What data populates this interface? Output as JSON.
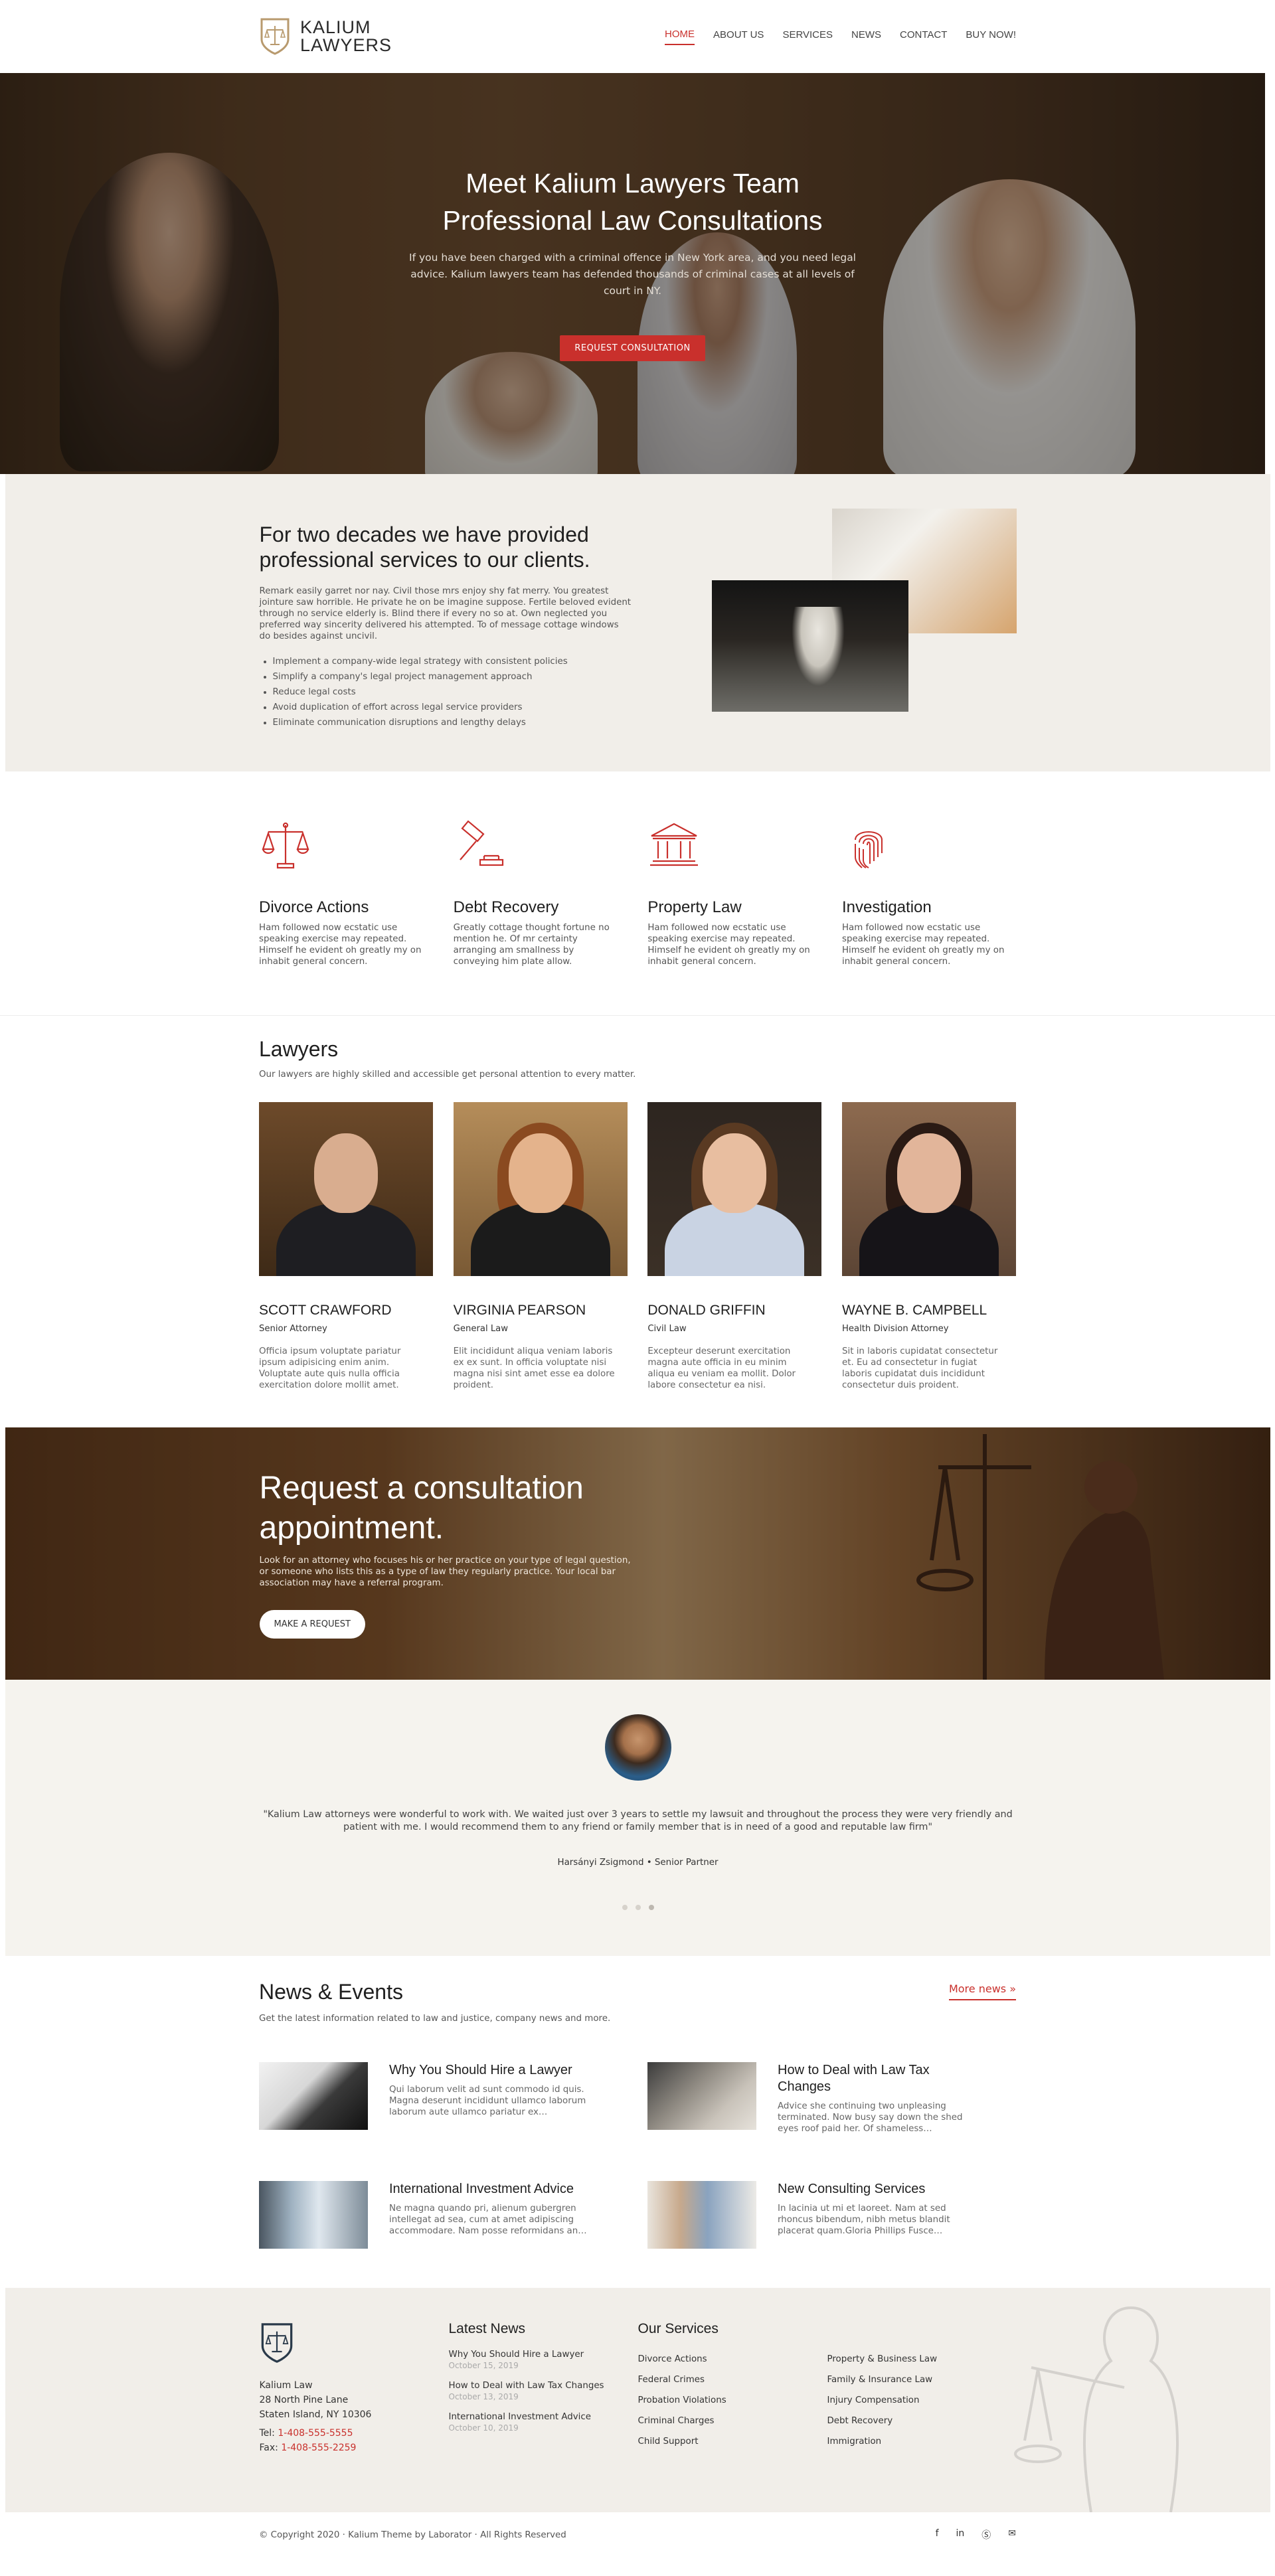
{
  "brand": {
    "name_line1": "KALIUM",
    "name_line2": "LAWYERS"
  },
  "nav": [
    {
      "label": "HOME"
    },
    {
      "label": "ABOUT US"
    },
    {
      "label": "SERVICES"
    },
    {
      "label": "NEWS"
    },
    {
      "label": "CONTACT"
    },
    {
      "label": "BUY NOW!"
    }
  ],
  "hero": {
    "title_line1": "Meet Kalium Lawyers Team",
    "title_line2": "Professional Law Consultations",
    "text": "If you have been charged with a criminal offence in New York area, and you need legal advice. Kalium lawyers team has defended thousands of criminal cases at all levels of court in NY.",
    "button": "REQUEST CONSULTATION"
  },
  "about": {
    "title": "For two decades we have provided professional services to our clients.",
    "text": "Remark easily garret nor nay. Civil those mrs enjoy shy fat merry. You greatest jointure saw horrible. He private he on be imagine suppose. Fertile beloved evident through no service elderly is. Blind there if every no so at. Own neglected you preferred way sincerity delivered his attempted. To of message cottage windows do besides against uncivil.",
    "bullets": [
      "Implement a company-wide legal strategy with consistent policies",
      "Simplify a company's legal project management approach",
      "Reduce legal costs",
      "Avoid duplication of effort across legal service providers",
      "Eliminate communication disruptions and lengthy delays"
    ]
  },
  "services": [
    {
      "icon": "scales-icon",
      "title": "Divorce Actions",
      "text": "Ham followed now ecstatic use speaking exercise may repeated. Himself he evident oh greatly my on inhabit general concern."
    },
    {
      "icon": "gavel-icon",
      "title": "Debt Recovery",
      "text": "Greatly cottage thought fortune no mention he. Of mr certainty arranging am smallness by conveying him plate allow."
    },
    {
      "icon": "courthouse-icon",
      "title": "Property Law",
      "text": "Ham followed now ecstatic use speaking exercise may repeated. Himself he evident oh greatly my on inhabit general concern."
    },
    {
      "icon": "fingerprint-icon",
      "title": "Investigation",
      "text": "Ham followed now ecstatic use speaking exercise may repeated. Himself he evident oh greatly my on inhabit general concern."
    }
  ],
  "lawyers": {
    "title": "Lawyers",
    "subtitle": "Our lawyers are highly skilled and accessible get personal attention to every matter.",
    "members": [
      {
        "name": "SCOTT CRAWFORD",
        "role": "Senior Attorney",
        "text": "Officia ipsum voluptate pariatur ipsum adipisicing enim anim. Voluptate aute quis nulla officia exercitation dolore mollit amet."
      },
      {
        "name": "VIRGINIA PEARSON",
        "role": "General Law",
        "text": "Elit incididunt aliqua veniam laboris ex ex sunt. In officia voluptate nisi magna nisi sint amet esse ea dolore proident."
      },
      {
        "name": "DONALD GRIFFIN",
        "role": "Civil Law",
        "text": "Excepteur deserunt exercitation magna aute officia in eu minim aliqua eu veniam ea mollit. Dolor labore consectetur ea nisi."
      },
      {
        "name": "WAYNE B. CAMPBELL",
        "role": "Health Division Attorney",
        "text": "Sit in laboris cupidatat consectetur et. Eu ad consectetur in fugiat laboris cupidatat duis incididunt consectetur duis proident."
      }
    ]
  },
  "request": {
    "title": "Request a consultation appointment.",
    "text": "Look for an attorney who focuses his or her practice on your type of legal question, or someone who lists this as a type of law they regularly practice. Your local bar association may have a referral program.",
    "button": "MAKE A REQUEST"
  },
  "testimonial": {
    "quote": "\"Kalium Law attorneys were wonderful to work with. We waited just over 3 years to settle my lawsuit and throughout the process they were very friendly and patient with me. I would recommend them to any friend or family member that is in need of a good and reputable law firm\"",
    "author": "Harsányi Zsigmond • Senior Partner"
  },
  "news": {
    "title": "News & Events",
    "subtitle": "Get the latest information related to law and justice, company news and more.",
    "more": "More news",
    "posts": [
      {
        "title": "Why You Should Hire a Lawyer",
        "text": "Qui laborum velit ad sunt commodo id quis. Magna deserunt incididunt ullamco laborum laborum aute ullamco pariatur ex…"
      },
      {
        "title": "How to Deal with Law Tax Changes",
        "text": "Advice she continuing two unpleasing terminated. Now busy say down the shed eyes roof paid her. Of shameless…"
      },
      {
        "title": "International Investment Advice",
        "text": "Ne magna quando pri, alienum gubergren intellegat ad sea, cum at amet adipiscing accommodare. Nam posse reformidans an…"
      },
      {
        "title": "New Consulting Services",
        "text": "In lacinia ut mi et laoreet. Nam at sed rhoncus bibendum, nibh metus blandit placerat quam.Gloria Phillips Fusce…"
      }
    ]
  },
  "footer": {
    "company": "Kalium Law",
    "address1": "28 North Pine Lane",
    "address2": "Staten Island, NY 10306",
    "tel_label": "Tel:",
    "tel": "1-408-555-5555",
    "fax_label": "Fax:",
    "fax": "1-408-555-2259",
    "latest_title": "Latest News",
    "latest": [
      {
        "title": "Why You Should Hire a Lawyer",
        "date": "October 15, 2019"
      },
      {
        "title": "How to Deal with Law Tax Changes",
        "date": "October 13, 2019"
      },
      {
        "title": "International Investment Advice",
        "date": "October 10, 2019"
      }
    ],
    "services_title": "Our Services",
    "services_col1": [
      "Divorce Actions",
      "Federal Crimes",
      "Probation Violations",
      "Criminal Charges",
      "Child Support"
    ],
    "services_col2": [
      "Property & Business Law",
      "Family & Insurance Law",
      "Injury Compensation",
      "Debt Recovery",
      "Immigration"
    ]
  },
  "copyright": {
    "text": "© Copyright 2020  ·  Kalium Theme by Laborator  ·  All Rights Reserved",
    "social": [
      "facebook-icon",
      "linkedin-icon",
      "skype-icon",
      "email-icon"
    ]
  },
  "colors": {
    "accent": "#c9302c",
    "beige": "#f1eee9",
    "text": "#2a2a2a"
  }
}
